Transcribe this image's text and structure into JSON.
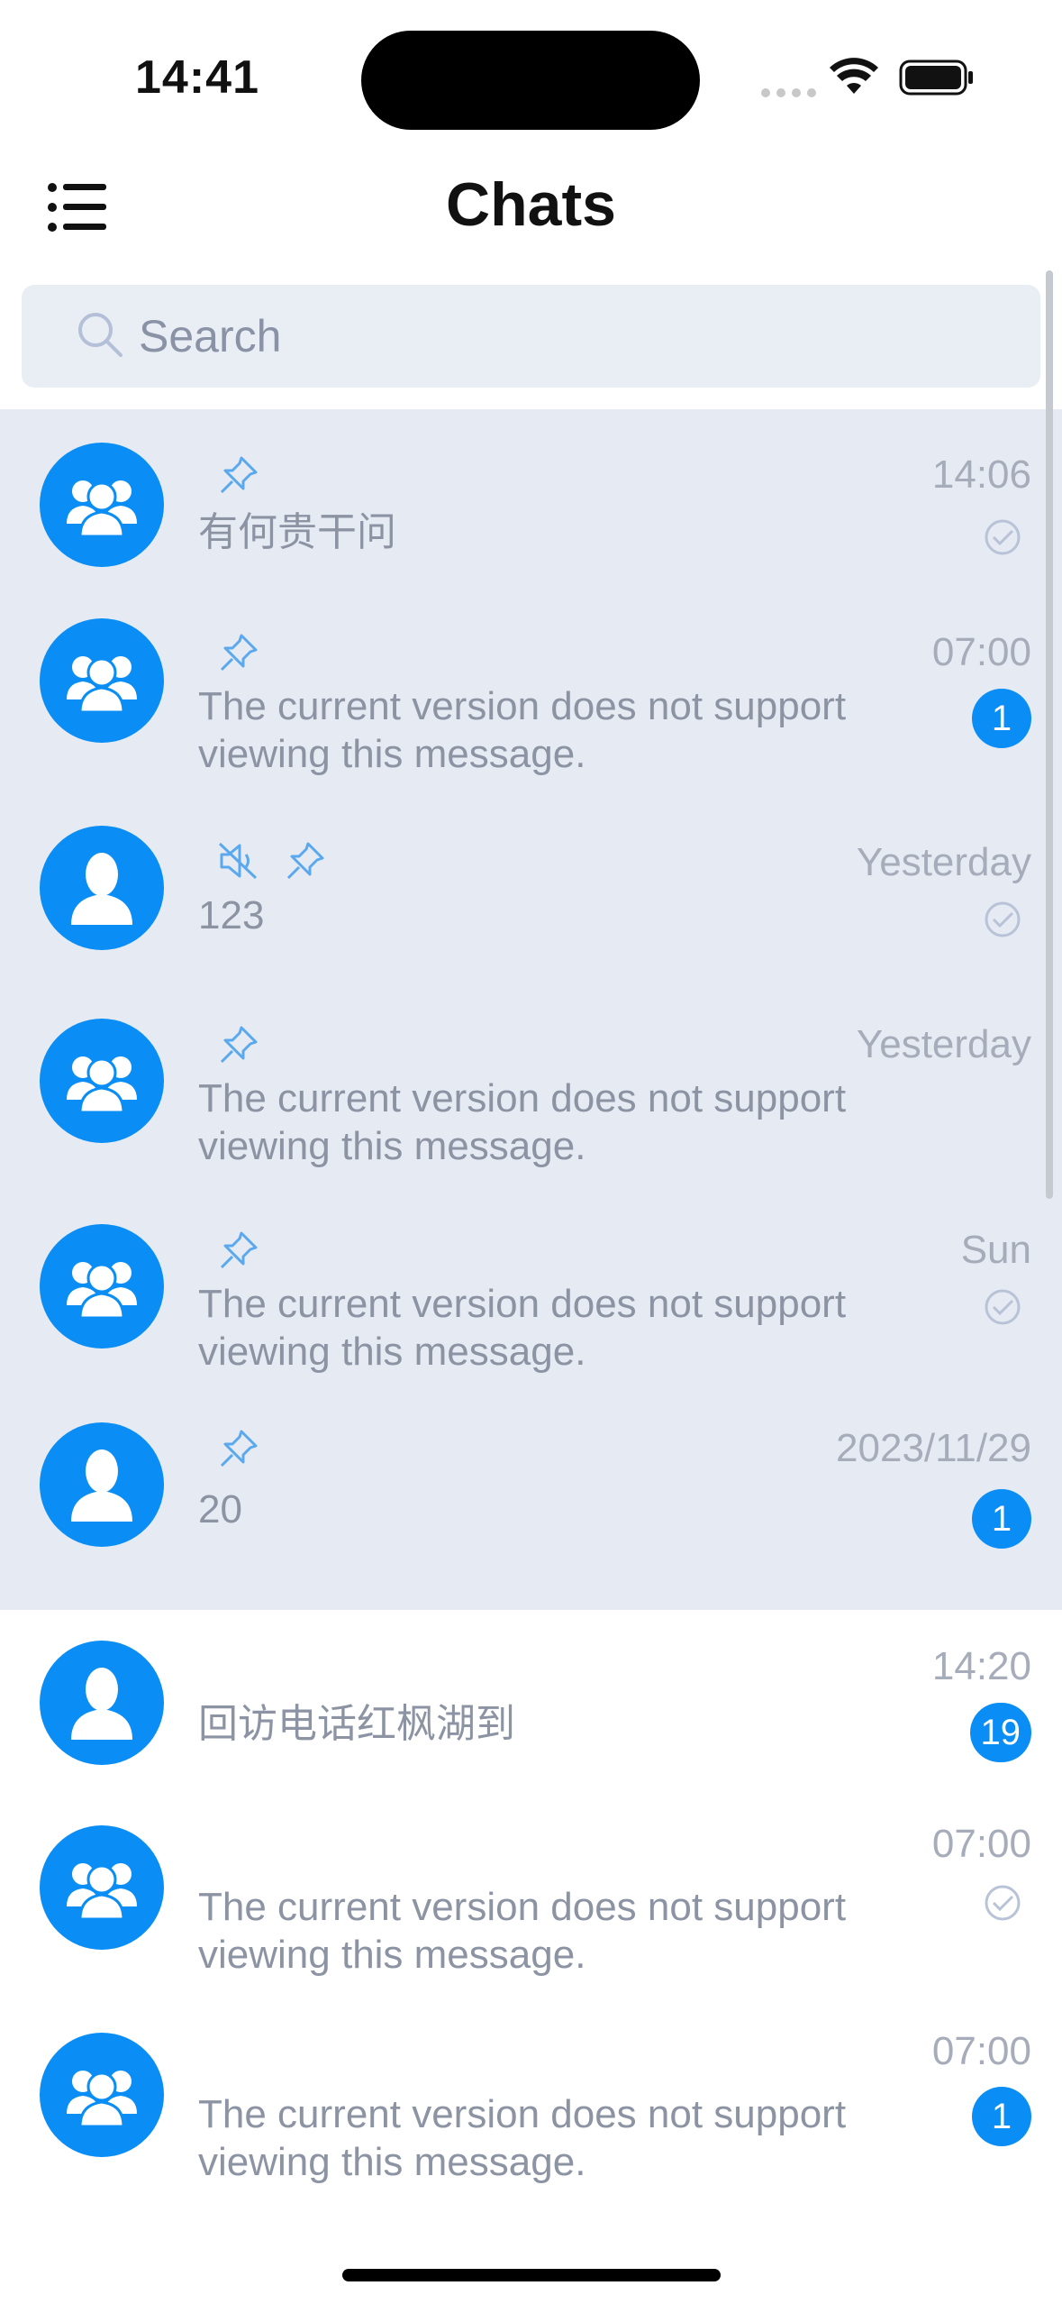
{
  "status_bar": {
    "time": "14:41"
  },
  "nav": {
    "title": "Chats"
  },
  "search": {
    "placeholder": "Search"
  },
  "colors": {
    "accent": "#0A8EF5",
    "pinned_bg": "#E6EBF3",
    "secondary_text": "#8C93A3"
  },
  "chats": [
    {
      "avatar": "group-avatar-icon",
      "muted": false,
      "pinned": true,
      "message": "有何贵干问",
      "time": "14:06",
      "badge": "",
      "read_mark": true
    },
    {
      "avatar": "group-avatar-icon",
      "muted": false,
      "pinned": true,
      "message": "The current version does not support viewing this message.",
      "time": "07:00",
      "badge": "1",
      "read_mark": false
    },
    {
      "avatar": "user-avatar-icon",
      "muted": true,
      "pinned": true,
      "message": "123",
      "time": "Yesterday",
      "badge": "",
      "read_mark": true
    },
    {
      "avatar": "group-avatar-icon",
      "muted": false,
      "pinned": true,
      "message": "The current version does not support viewing this message.",
      "time": "Yesterday",
      "badge": "",
      "read_mark": false
    },
    {
      "avatar": "group-avatar-icon",
      "muted": false,
      "pinned": true,
      "message": "The current version does not support viewing this message.",
      "time": "Sun",
      "badge": "",
      "read_mark": true
    },
    {
      "avatar": "user-avatar-icon",
      "muted": false,
      "pinned": true,
      "message": "20",
      "time": "2023/11/29",
      "badge": "1",
      "read_mark": false
    },
    {
      "avatar": "user-avatar-icon",
      "muted": false,
      "pinned": false,
      "message": "回访电话红枫湖到",
      "time": "14:20",
      "badge": "19",
      "read_mark": false
    },
    {
      "avatar": "group-avatar-icon",
      "muted": false,
      "pinned": false,
      "message": "The current version does not support viewing this message.",
      "time": "07:00",
      "badge": "",
      "read_mark": true
    },
    {
      "avatar": "group-avatar-icon",
      "muted": false,
      "pinned": false,
      "message": "The current version does not support viewing this message.",
      "time": "07:00",
      "badge": "1",
      "read_mark": false
    }
  ]
}
